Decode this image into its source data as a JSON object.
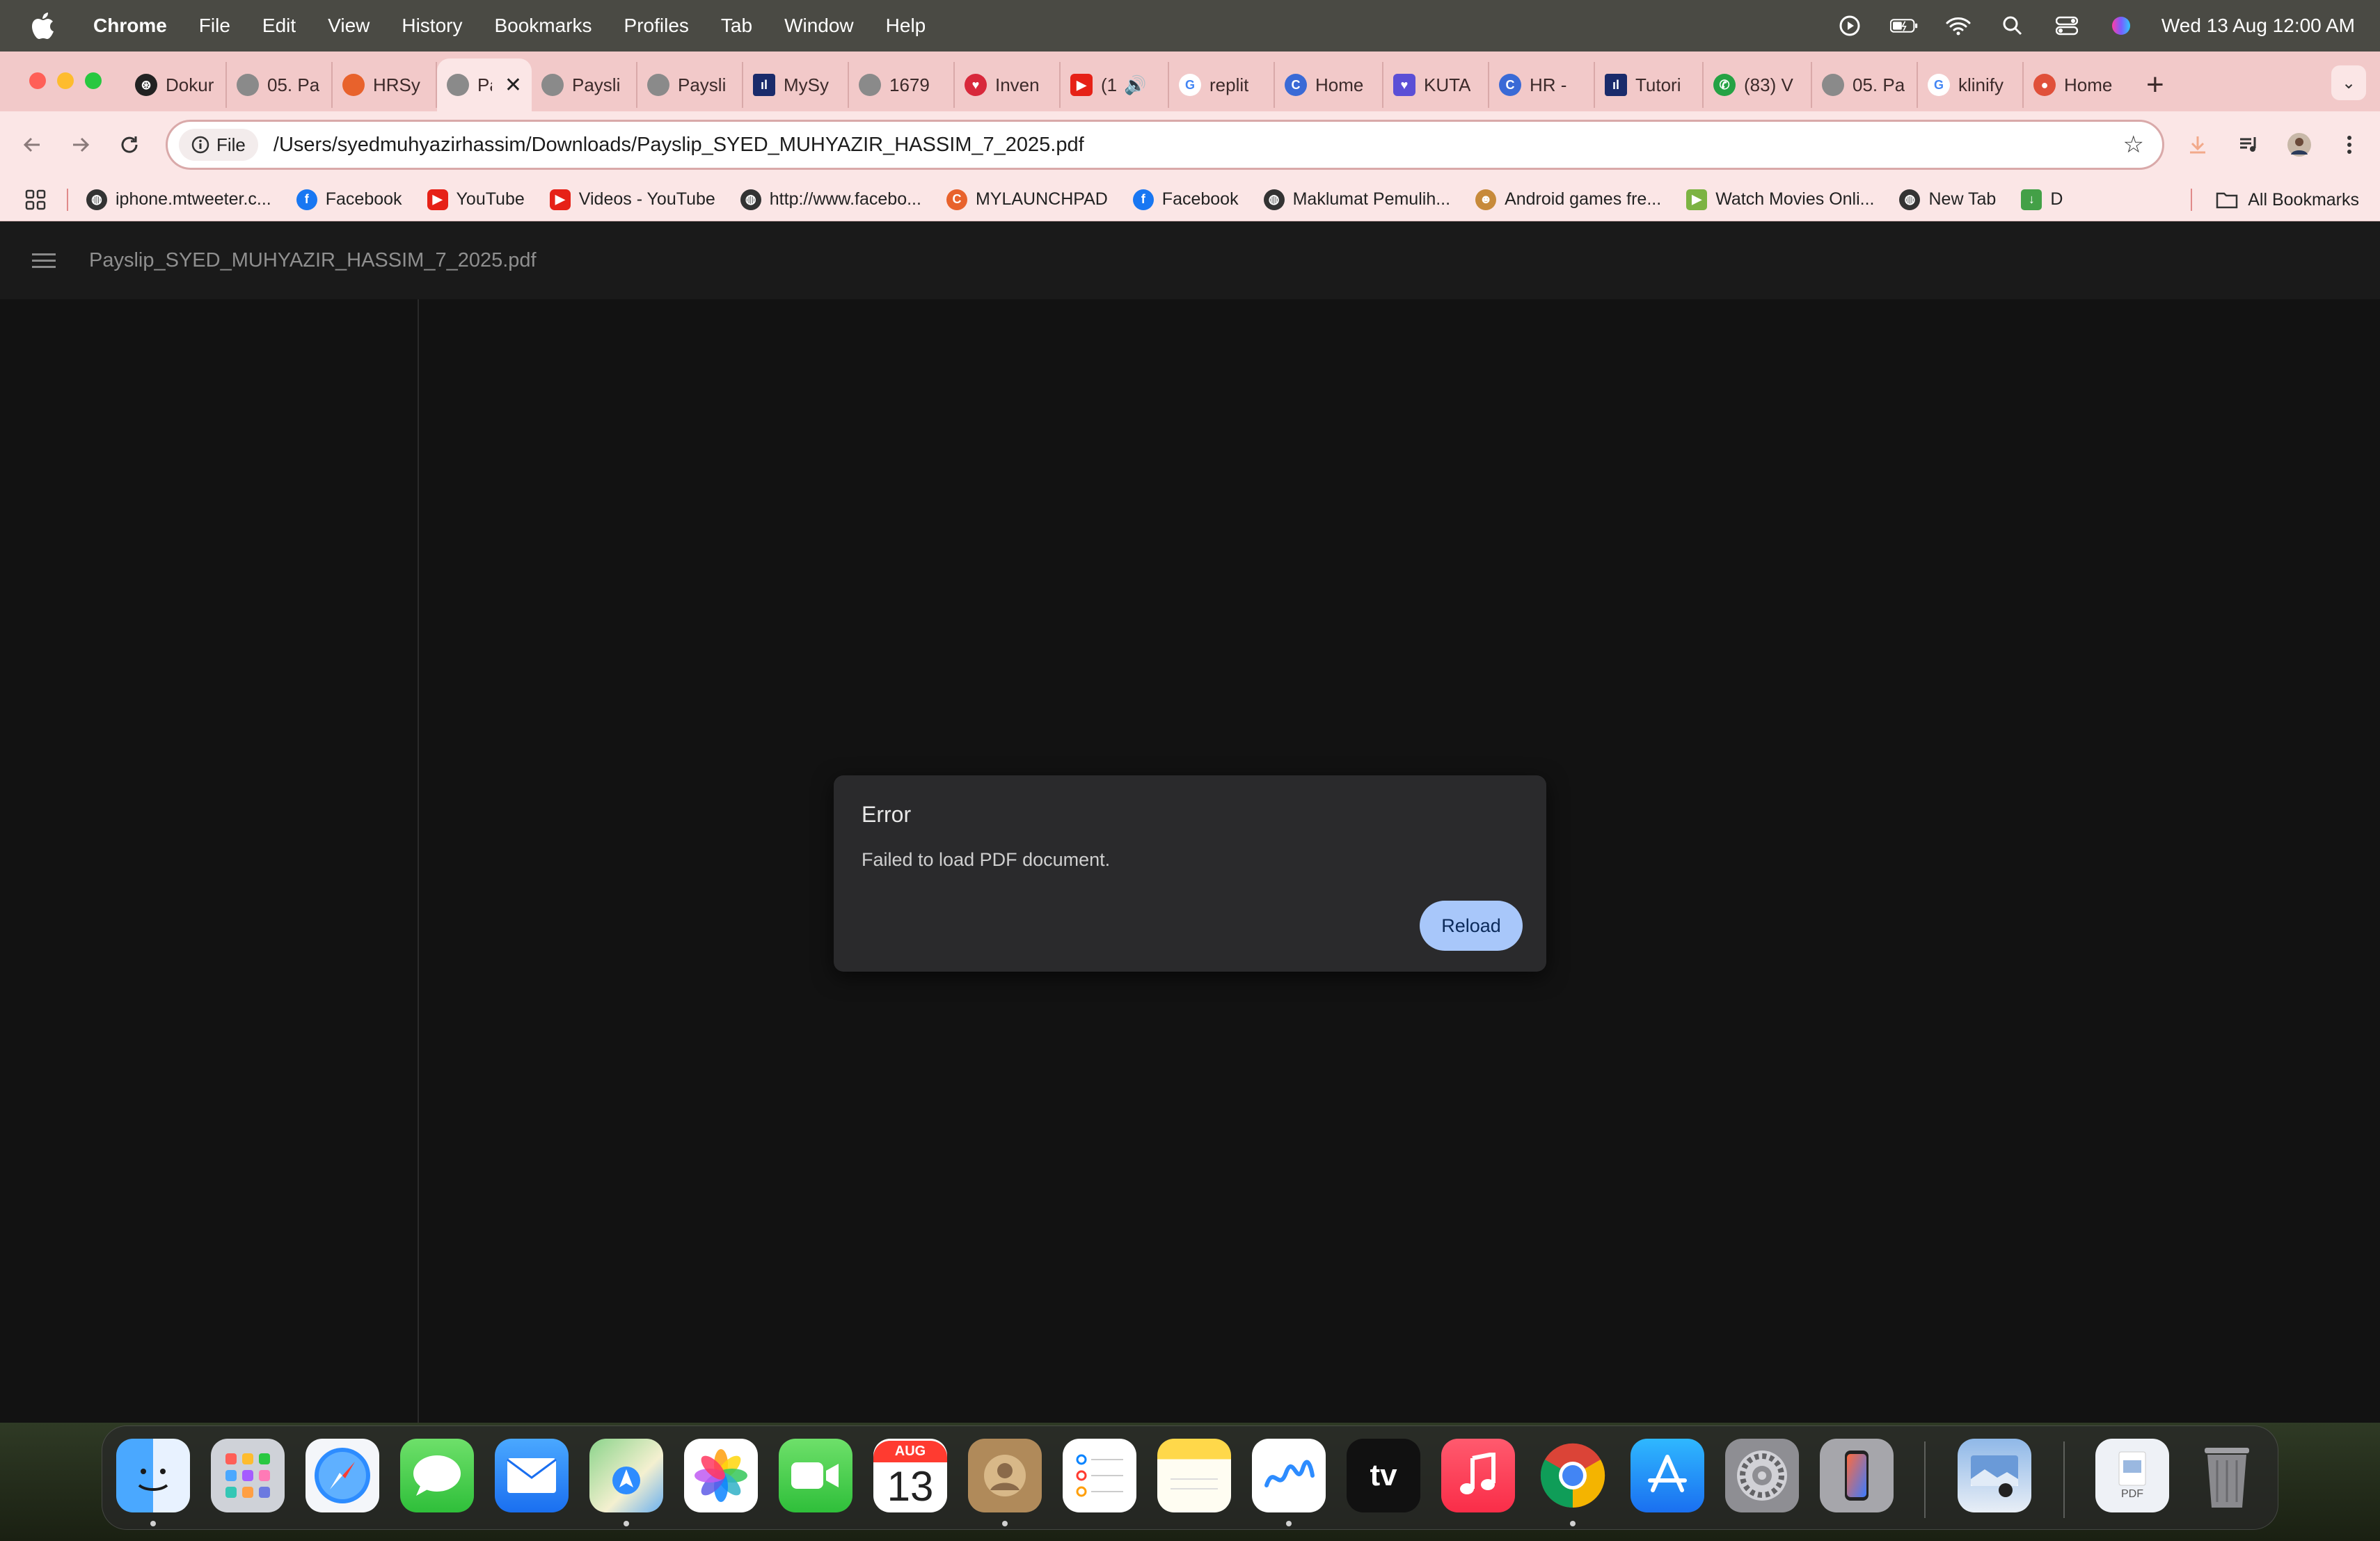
{
  "menubar": {
    "app_name": "Chrome",
    "items": [
      "File",
      "Edit",
      "View",
      "History",
      "Bookmarks",
      "Profiles",
      "Tab",
      "Window",
      "Help"
    ],
    "clock": "Wed 13 Aug  12:00 AM"
  },
  "tabs": [
    {
      "title": "Dokur",
      "icon_color": "#222222"
    },
    {
      "title": "05. Pa",
      "icon_color": "#8a8a8a"
    },
    {
      "title": "HRSy",
      "icon_color": "#e8622c"
    },
    {
      "title": "Pa",
      "icon_color": "#8a8a8a",
      "active": true
    },
    {
      "title": "Paysli",
      "icon_color": "#8a8a8a"
    },
    {
      "title": "Paysli",
      "icon_color": "#8a8a8a"
    },
    {
      "title": "MySy",
      "icon_color": "#1a2b6b"
    },
    {
      "title": "1679",
      "icon_color": "#8a8a8a"
    },
    {
      "title": "Inven",
      "icon_color": "#d8283b"
    },
    {
      "title": "(1",
      "icon_color": "#e62117"
    },
    {
      "title": "replit",
      "icon_color": "#4285f4"
    },
    {
      "title": "Home",
      "icon_color": "#3a6ad6"
    },
    {
      "title": "KUTA",
      "icon_color": "#5b4fd6"
    },
    {
      "title": "HR -",
      "icon_color": "#3a6ad6"
    },
    {
      "title": "Tutori",
      "icon_color": "#1a2b6b"
    },
    {
      "title": "(83) V",
      "icon_color": "#25a244"
    },
    {
      "title": "05. Pa",
      "icon_color": "#8a8a8a"
    },
    {
      "title": "klinify",
      "icon_color": "#4285f4"
    },
    {
      "title": "Home",
      "icon_color": "#e0503a"
    }
  ],
  "toolbar": {
    "chip_label": "File",
    "url": "/Users/syedmuhyazirhassim/Downloads/Payslip_SYED_MUHYAZIR_HASSIM_7_2025.pdf"
  },
  "bookmarks": [
    {
      "label": "iphone.mtweeter.c...",
      "icon_color": "#333333"
    },
    {
      "label": "Facebook",
      "icon_color": "#1877f2"
    },
    {
      "label": "YouTube",
      "icon_color": "#e62117"
    },
    {
      "label": "Videos - YouTube",
      "icon_color": "#e62117"
    },
    {
      "label": "http://www.facebo...",
      "icon_color": "#333333"
    },
    {
      "label": "MYLAUNCHPAD",
      "icon_color": "#e8622c"
    },
    {
      "label": "Facebook",
      "icon_color": "#1877f2"
    },
    {
      "label": "Maklumat Pemulih...",
      "icon_color": "#333333"
    },
    {
      "label": "Android games fre...",
      "icon_color": "#c78a3a"
    },
    {
      "label": "Watch Movies Onli...",
      "icon_color": "#7cb342"
    },
    {
      "label": "New Tab",
      "icon_color": "#333333"
    },
    {
      "label": "D",
      "icon_color": "#43a047"
    }
  ],
  "all_bookmarks": "All Bookmarks",
  "pdf": {
    "filename": "Payslip_SYED_MUHYAZIR_HASSIM_7_2025.pdf",
    "dialog_title": "Error",
    "dialog_message": "Failed to load PDF document.",
    "reload_label": "Reload"
  },
  "dock": {
    "calendar_month": "AUG",
    "calendar_day": "13",
    "tv_label": "tv",
    "pdf_label": "PDF"
  },
  "colors": {
    "tabstrip": "#f2c9c9",
    "toolbar": "#fbe6e6",
    "viewer_bg": "#121212",
    "reload_button": "#a8c7fa"
  }
}
